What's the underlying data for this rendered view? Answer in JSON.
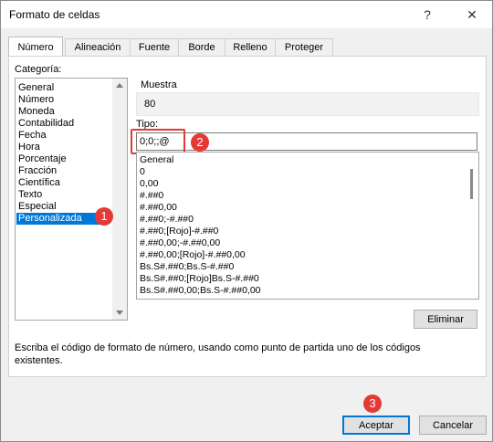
{
  "window": {
    "title": "Formato de celdas",
    "help_label": "?",
    "close_label": "✕"
  },
  "tabs": [
    {
      "label": "Número",
      "active": true
    },
    {
      "label": "Alineación",
      "active": false
    },
    {
      "label": "Fuente",
      "active": false
    },
    {
      "label": "Borde",
      "active": false
    },
    {
      "label": "Relleno",
      "active": false
    },
    {
      "label": "Proteger",
      "active": false
    }
  ],
  "category": {
    "label": "Categoría:",
    "items": [
      "General",
      "Número",
      "Moneda",
      "Contabilidad",
      "Fecha",
      "Hora",
      "Porcentaje",
      "Fracción",
      "Científica",
      "Texto",
      "Especial",
      "Personalizada"
    ],
    "selected": "Personalizada"
  },
  "sample": {
    "label": "Muestra",
    "value": "80"
  },
  "type": {
    "label": "Tipo:",
    "value": "0;0;;@"
  },
  "formats": [
    "General",
    "0",
    "0,00",
    "#.##0",
    "#.##0,00",
    "#.##0;-#.##0",
    "#.##0;[Rojo]-#.##0",
    "#.##0,00;-#.##0,00",
    "#.##0,00;[Rojo]-#.##0,00",
    "Bs.S#.##0;Bs.S-#.##0",
    "Bs.S#.##0;[Rojo]Bs.S-#.##0",
    "Bs.S#.##0,00;Bs.S-#.##0,00"
  ],
  "buttons": {
    "delete": "Eliminar",
    "accept": "Aceptar",
    "cancel": "Cancelar"
  },
  "description": "Escriba el código de formato de número, usando como punto de partida uno de los códigos existentes.",
  "badges": [
    "1",
    "2",
    "3"
  ],
  "colors": {
    "selection": "#0078d7",
    "callout": "#e53935"
  }
}
